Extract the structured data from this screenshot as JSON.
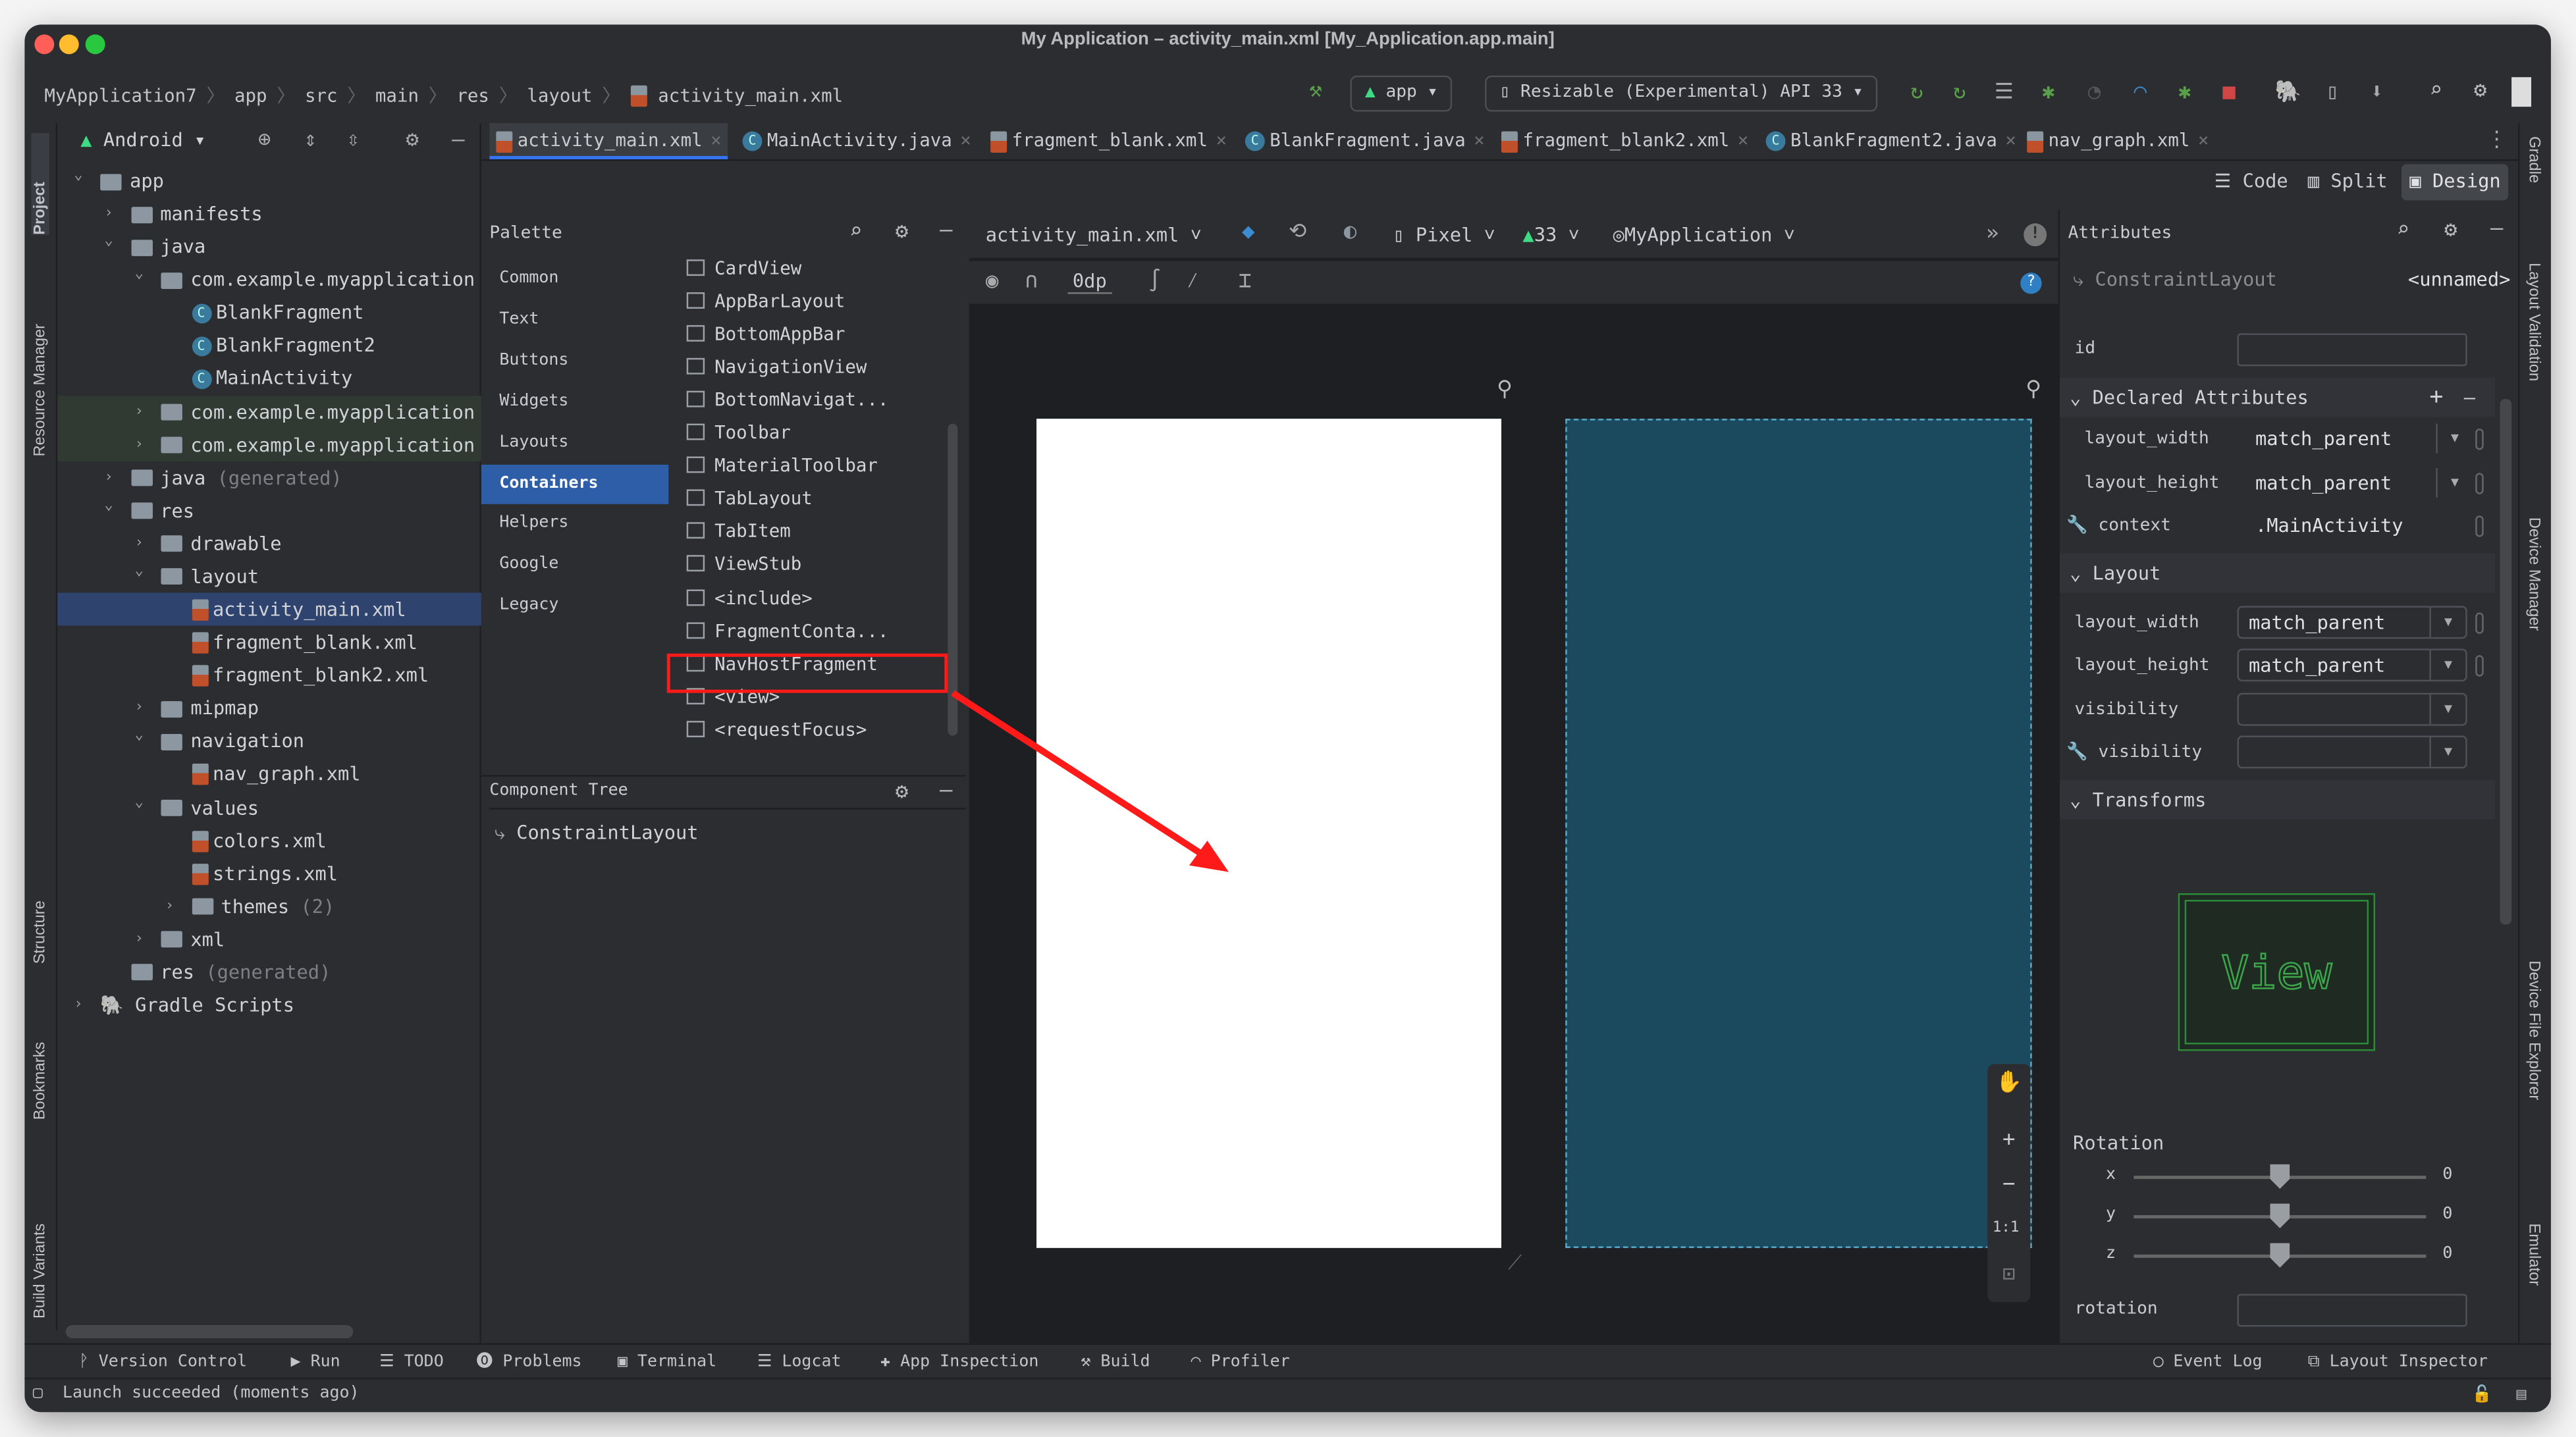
{
  "window": {
    "title": "My Application – activity_main.xml [My_Application.app.main]"
  },
  "breadcrumb": [
    "MyApplication7",
    "app",
    "src",
    "main",
    "res",
    "layout",
    "activity_main.xml"
  ],
  "run_toolbar": {
    "config": "app",
    "device": "Resizable (Experimental) API 33"
  },
  "left_stripe": [
    "Project",
    "Resource Manager",
    "Structure",
    "Bookmarks",
    "Build Variants"
  ],
  "right_stripe": [
    "Gradle",
    "Layout Validation",
    "Device Manager",
    "Device File Explorer",
    "Emulator"
  ],
  "project": {
    "view": "Android",
    "tree": [
      {
        "label": "app",
        "level": 0,
        "arrow": "v",
        "icon": "folder"
      },
      {
        "label": "manifests",
        "level": 1,
        "arrow": ">",
        "icon": "folder"
      },
      {
        "label": "java",
        "level": 1,
        "arrow": "v",
        "icon": "folder"
      },
      {
        "label": "com.example.myapplication",
        "level": 2,
        "arrow": "v",
        "icon": "package"
      },
      {
        "label": "BlankFragment",
        "level": 3,
        "icon": "class"
      },
      {
        "label": "BlankFragment2",
        "level": 3,
        "icon": "class"
      },
      {
        "label": "MainActivity",
        "level": 3,
        "icon": "class"
      },
      {
        "label": "com.example.myapplication",
        "level": 2,
        "arrow": ">",
        "icon": "package",
        "state": "test"
      },
      {
        "label": "com.example.myapplication",
        "level": 2,
        "arrow": ">",
        "icon": "package",
        "state": "test"
      },
      {
        "label": "java",
        "suffix": "(generated)",
        "level": 1,
        "arrow": ">",
        "icon": "folder"
      },
      {
        "label": "res",
        "level": 1,
        "arrow": "v",
        "icon": "folder"
      },
      {
        "label": "drawable",
        "level": 2,
        "arrow": ">",
        "icon": "folder"
      },
      {
        "label": "layout",
        "level": 2,
        "arrow": "v",
        "icon": "folder"
      },
      {
        "label": "activity_main.xml",
        "level": 3,
        "icon": "xml",
        "state": "selected"
      },
      {
        "label": "fragment_blank.xml",
        "level": 3,
        "icon": "xml"
      },
      {
        "label": "fragment_blank2.xml",
        "level": 3,
        "icon": "xml"
      },
      {
        "label": "mipmap",
        "level": 2,
        "arrow": ">",
        "icon": "folder"
      },
      {
        "label": "navigation",
        "level": 2,
        "arrow": "v",
        "icon": "folder"
      },
      {
        "label": "nav_graph.xml",
        "level": 3,
        "icon": "xml"
      },
      {
        "label": "values",
        "level": 2,
        "arrow": "v",
        "icon": "folder"
      },
      {
        "label": "colors.xml",
        "level": 3,
        "icon": "xml"
      },
      {
        "label": "strings.xml",
        "level": 3,
        "icon": "xml"
      },
      {
        "label": "themes",
        "suffix": "(2)",
        "level": 3,
        "arrow": ">",
        "icon": "folder"
      },
      {
        "label": "xml",
        "level": 2,
        "arrow": ">",
        "icon": "folder"
      },
      {
        "label": "res",
        "suffix": "(generated)",
        "level": 1,
        "icon": "folder"
      },
      {
        "label": "Gradle Scripts",
        "level": 0,
        "arrow": ">",
        "icon": "gradle"
      }
    ]
  },
  "editor_tabs": [
    {
      "label": "activity_main.xml",
      "icon": "xml",
      "active": true
    },
    {
      "label": "MainActivity.java",
      "icon": "class"
    },
    {
      "label": "fragment_blank.xml",
      "icon": "xml"
    },
    {
      "label": "BlankFragment.java",
      "icon": "class"
    },
    {
      "label": "fragment_blank2.xml",
      "icon": "xml"
    },
    {
      "label": "BlankFragment2.java",
      "icon": "class"
    },
    {
      "label": "nav_graph.xml",
      "icon": "xml"
    }
  ],
  "view_modes": {
    "code": "Code",
    "split": "Split",
    "design": "Design",
    "selected": "Design"
  },
  "palette": {
    "title": "Palette",
    "categories": [
      "Common",
      "Text",
      "Buttons",
      "Widgets",
      "Layouts",
      "Containers",
      "Helpers",
      "Google",
      "Legacy"
    ],
    "selected_category": "Containers",
    "items": [
      "CardView",
      "AppBarLayout",
      "BottomAppBar",
      "NavigationView",
      "BottomNavigat...",
      "Toolbar",
      "MaterialToolbar",
      "TabLayout",
      "TabItem",
      "ViewStub",
      "<include>",
      "FragmentConta...",
      "NavHostFragment",
      "<view>",
      "<requestFocus>"
    ],
    "highlighted_item": "NavHostFragment"
  },
  "component_tree": {
    "title": "Component Tree",
    "items": [
      "ConstraintLayout"
    ]
  },
  "design_toolbar": {
    "file": "activity_main.xml",
    "device": "Pixel",
    "api": "33",
    "theme": "MyApplication",
    "margin": "0dp"
  },
  "zoom_controls": {
    "one_to_one": "1:1"
  },
  "attributes": {
    "title": "Attributes",
    "component": "ConstraintLayout",
    "component_id": "<unnamed>",
    "id_label": "id",
    "id_value": "",
    "declared": {
      "title": "Declared Attributes",
      "rows": [
        {
          "name": "layout_width",
          "value": "match_parent"
        },
        {
          "name": "layout_height",
          "value": "match_parent"
        },
        {
          "name": "context",
          "value": ".MainActivity",
          "tools": true
        }
      ]
    },
    "layout": {
      "title": "Layout",
      "rows": [
        {
          "name": "layout_width",
          "value": "match_parent"
        },
        {
          "name": "layout_height",
          "value": "match_parent"
        },
        {
          "name": "visibility",
          "value": ""
        },
        {
          "name": "visibility",
          "value": "",
          "tools": true
        }
      ]
    },
    "transforms": {
      "title": "Transforms",
      "preview": "View",
      "rotation_label": "Rotation",
      "axes": [
        {
          "axis": "x",
          "value": "0"
        },
        {
          "axis": "y",
          "value": "0"
        },
        {
          "axis": "z",
          "value": "0"
        }
      ],
      "rotation_field_label": "rotation",
      "rotation_value": ""
    }
  },
  "bottom_tools": [
    "Version Control",
    "Run",
    "TODO",
    "Problems",
    "Terminal",
    "Logcat",
    "App Inspection",
    "Build",
    "Profiler"
  ],
  "bottom_right_tools": [
    "Event Log",
    "Layout Inspector"
  ],
  "status": "Launch succeeded (moments ago)",
  "colors": {
    "accent": "#3574f0",
    "annotation_red": "#ff1a1a",
    "blueprint": "#1b4a5e",
    "window_bg": "#2b2d30"
  }
}
